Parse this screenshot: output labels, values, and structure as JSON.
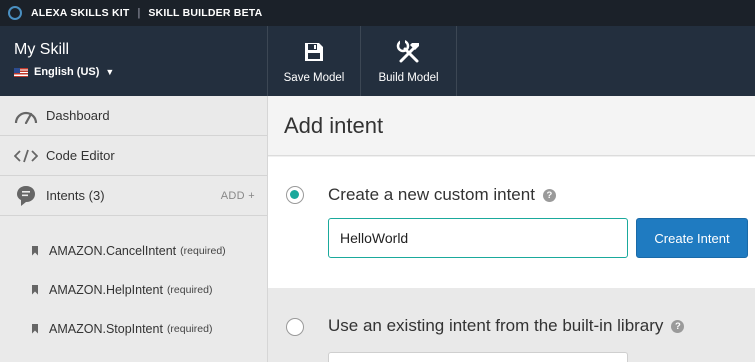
{
  "topbar": {
    "product": "ALEXA SKILLS KIT",
    "separator": "|",
    "section": "SKILL BUILDER BETA"
  },
  "header": {
    "skill_name": "My Skill",
    "locale": "English (US)",
    "save_label": "Save Model",
    "build_label": "Build Model"
  },
  "sidebar": {
    "items": [
      {
        "label": "Dashboard",
        "icon": "gauge-icon"
      },
      {
        "label": "Code Editor",
        "icon": "code-icon"
      },
      {
        "label": "Intents (3)",
        "icon": "chat-head-icon",
        "action": "ADD +"
      }
    ],
    "intents": [
      {
        "name": "AMAZON.CancelIntent",
        "tag": "(required)"
      },
      {
        "name": "AMAZON.HelpIntent",
        "tag": "(required)"
      },
      {
        "name": "AMAZON.StopIntent",
        "tag": "(required)"
      }
    ]
  },
  "main": {
    "title": "Add intent",
    "custom_option": {
      "label": "Create a new custom intent",
      "help": "?",
      "selected": true,
      "input_value": "HelloWorld",
      "button": "Create Intent"
    },
    "library_option": {
      "label": "Use an existing intent from the built-in library",
      "help": "?",
      "selected": false
    }
  },
  "colors": {
    "topbar": "#1b2129",
    "header": "#232f3e",
    "accent": "#1aa99c",
    "primary_button": "#1f7bc1"
  }
}
